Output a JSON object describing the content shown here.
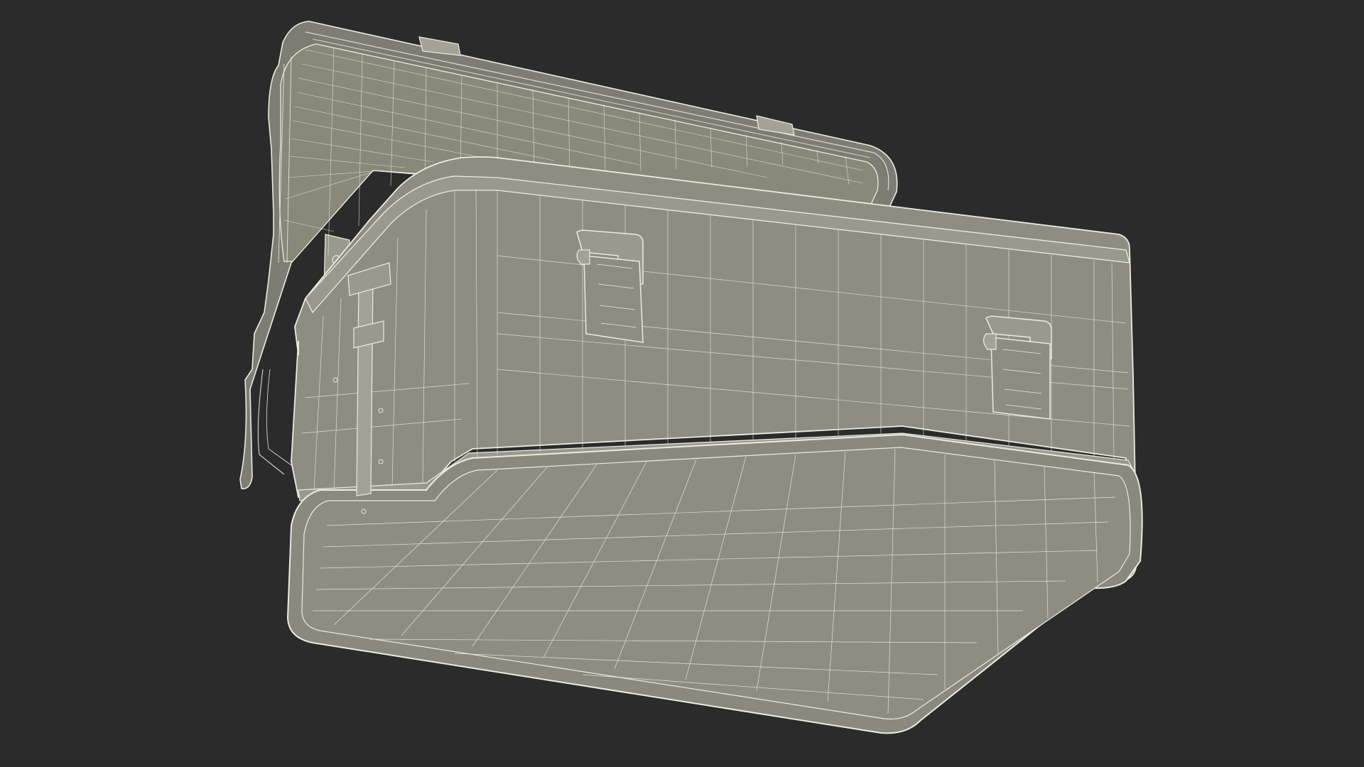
{
  "scene": {
    "subject": "open-storage-case-wireframe",
    "view": "underside-low-angle"
  },
  "colors": {
    "background": "#2b2b2b",
    "surface": "#8e8d82",
    "surface_dark": "#7d7c72",
    "surface_light": "#a3a296",
    "wire": "#ecebe2"
  }
}
